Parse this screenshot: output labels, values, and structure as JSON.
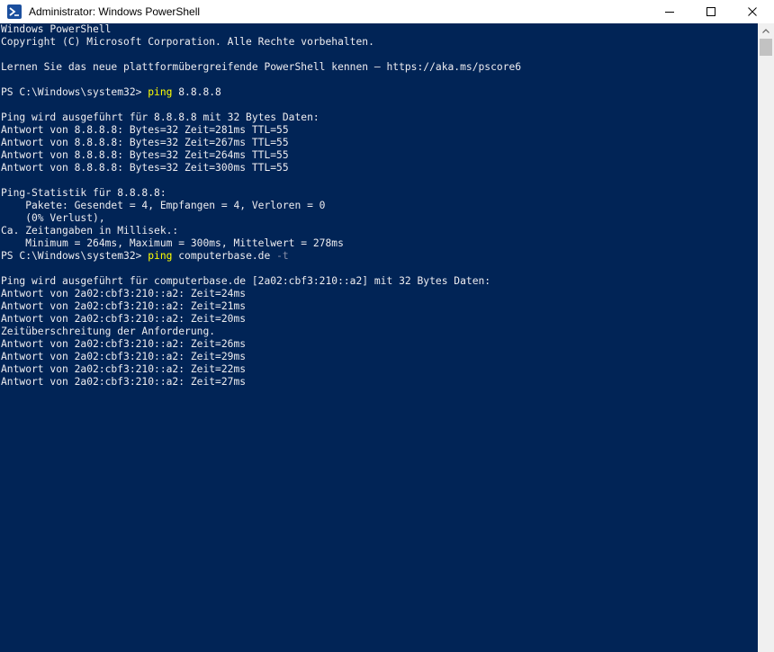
{
  "window": {
    "title": "Administrator: Windows PowerShell"
  },
  "console": {
    "prompt": "PS C:\\Windows\\system32> ",
    "lines": [
      "Windows PowerShell",
      "Copyright (C) Microsoft Corporation. Alle Rechte vorbehalten.",
      "",
      "Lernen Sie das neue plattformübergreifende PowerShell kennen – https://aka.ms/pscore6",
      "",
      "",
      "",
      "Ping wird ausgeführt für 8.8.8.8 mit 32 Bytes Daten:",
      "Antwort von 8.8.8.8: Bytes=32 Zeit=281ms TTL=55",
      "Antwort von 8.8.8.8: Bytes=32 Zeit=267ms TTL=55",
      "Antwort von 8.8.8.8: Bytes=32 Zeit=264ms TTL=55",
      "Antwort von 8.8.8.8: Bytes=32 Zeit=300ms TTL=55",
      "",
      "Ping-Statistik für 8.8.8.8:",
      "    Pakete: Gesendet = 4, Empfangen = 4, Verloren = 0",
      "    (0% Verlust),",
      "Ca. Zeitangaben in Millisek.:",
      "    Minimum = 264ms, Maximum = 300ms, Mittelwert = 278ms",
      "",
      "",
      "Ping wird ausgeführt für computerbase.de [2a02:cbf3:210::a2] mit 32 Bytes Daten:",
      "Antwort von 2a02:cbf3:210::a2: Zeit=24ms",
      "Antwort von 2a02:cbf3:210::a2: Zeit=21ms",
      "Antwort von 2a02:cbf3:210::a2: Zeit=20ms",
      "Zeitüberschreitung der Anforderung.",
      "Antwort von 2a02:cbf3:210::a2: Zeit=26ms",
      "Antwort von 2a02:cbf3:210::a2: Zeit=29ms",
      "Antwort von 2a02:cbf3:210::a2: Zeit=22ms",
      "Antwort von 2a02:cbf3:210::a2: Zeit=27ms"
    ],
    "command1": {
      "name": "ping",
      "args": " 8.8.8.8"
    },
    "command2": {
      "name": "ping",
      "args": " computerbase.de ",
      "param": "-t"
    }
  },
  "colors": {
    "console_background": "#012456",
    "console_text": "#eeedf0",
    "command": "#ffff00",
    "parameter": "#8a8fa8"
  },
  "icons": {
    "app": "powershell-icon",
    "minimize": "minimize-icon",
    "maximize": "maximize-icon",
    "close": "close-icon",
    "scroll_up": "chevron-up-icon"
  }
}
